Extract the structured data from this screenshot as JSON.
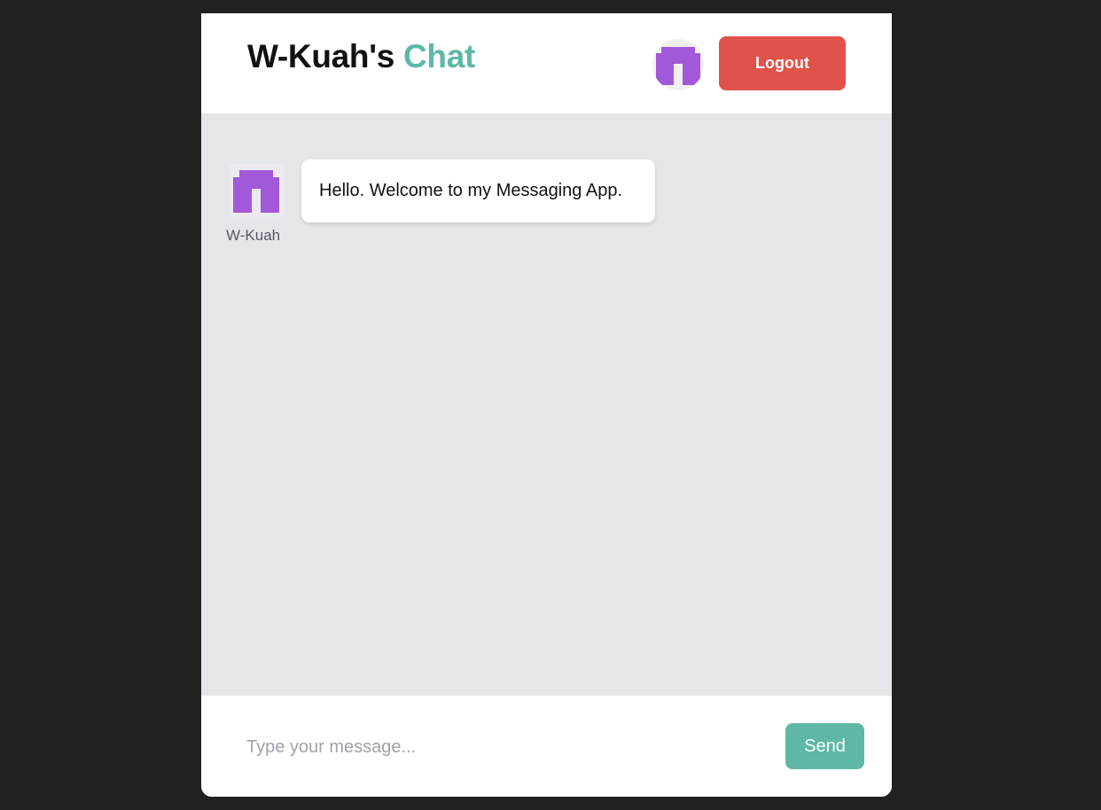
{
  "header": {
    "title_prefix": "W-Kuah's",
    "title_accent": "Chat",
    "avatar_icon": "identicon-avatar",
    "logout_label": "Logout"
  },
  "messages": [
    {
      "sender": "W-Kuah",
      "text": "Hello. Welcome to my Messaging App.",
      "avatar_icon": "identicon-avatar"
    }
  ],
  "composer": {
    "placeholder": "Type your message...",
    "value": "",
    "send_label": "Send"
  },
  "colors": {
    "page_background": "#212121",
    "accent": "#5fb8a6",
    "logout": "#e0524a",
    "avatar_purple": "#a259d9",
    "messages_background": "#e5e6ea"
  }
}
